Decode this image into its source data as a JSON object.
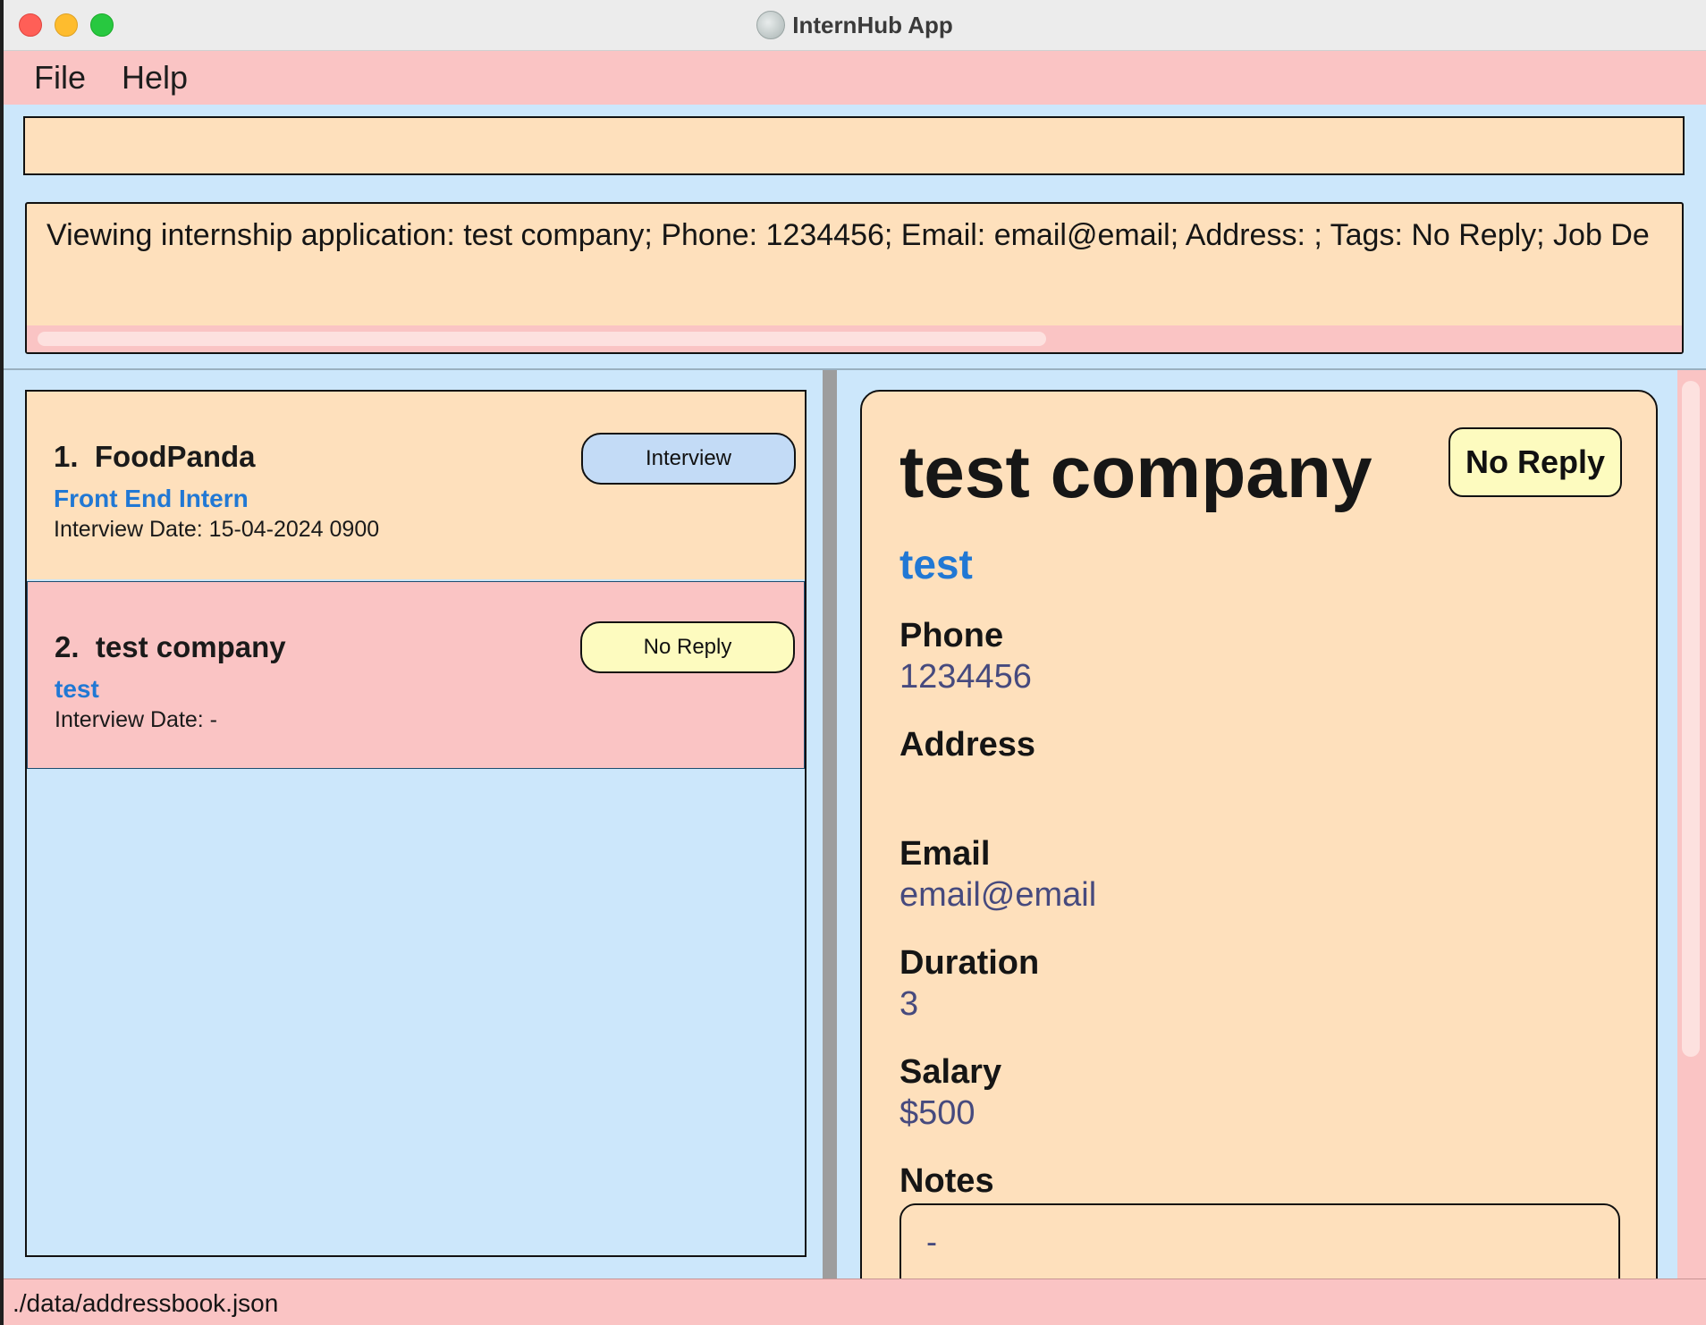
{
  "window": {
    "title": "InternHub App",
    "icon": "app-logo-icon"
  },
  "menu": {
    "file": "File",
    "help": "Help"
  },
  "command": {
    "value": "",
    "placeholder": ""
  },
  "result": {
    "text": "Viewing internship application: test company; Phone: 1234456; Email: email@email; Address: ; Tags: No Reply; Job De"
  },
  "applications": [
    {
      "index": "1.",
      "company": "FoodPanda",
      "role": "Front End Intern",
      "interview_date": "Interview Date: 15-04-2024 0900",
      "status": "Interview"
    },
    {
      "index": "2.",
      "company": "test company",
      "role": "test",
      "interview_date": "Interview Date: -",
      "status": "No Reply"
    }
  ],
  "detail": {
    "company": "test company",
    "status": "No Reply",
    "role": "test",
    "phone_label": "Phone",
    "phone": "1234456",
    "address_label": "Address",
    "address": "",
    "email_label": "Email",
    "email": "email@email",
    "duration_label": "Duration",
    "duration": "3",
    "salary_label": "Salary",
    "salary": "$500",
    "notes_label": "Notes",
    "notes": "-"
  },
  "status_bar": {
    "path": "./data/addressbook.json"
  },
  "colors": {
    "background": "#cce7fb",
    "menu": "#fac4c4",
    "panel": "#fee0bc",
    "interview_tag": "#c3dbf6",
    "no_reply_tag": "#fdfbbf",
    "role_text": "#2178d4",
    "value_text": "#464a7e",
    "selected_card": "#fac4c4"
  }
}
